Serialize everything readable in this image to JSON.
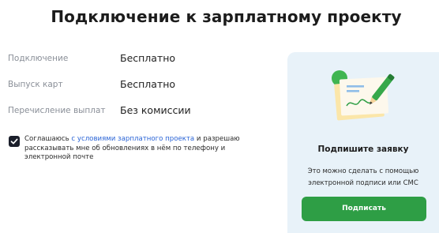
{
  "page": {
    "title": "Подключение к зарплатному проекту"
  },
  "terms": [
    {
      "label": "Подключение",
      "value": "Бесплатно"
    },
    {
      "label": "Выпуск карт",
      "value": "Бесплатно"
    },
    {
      "label": "Перечисление выплат",
      "value": "Без комиссии"
    }
  ],
  "consent": {
    "checked": true,
    "text_before": "Соглашаюсь ",
    "link_text": "с условиями зарплатного проекта",
    "text_after": " и разрешаю рассказывать мне об обновлениях в нём по телефону и электронной почте"
  },
  "sign_panel": {
    "title": "Подпишите заявку",
    "description_line1": "Это можно сделать с помощью",
    "description_line2": "электронной подписи или СМС",
    "button_label": "Подписать"
  },
  "colors": {
    "accent_green": "#2e9e45",
    "link_blue": "#2a64d6",
    "panel_bg": "#e8f2f9",
    "checkbox_fill": "#1b1f2b"
  },
  "icons": [
    "checkmark-icon",
    "signed-document-illustration",
    "pen-icon"
  ]
}
